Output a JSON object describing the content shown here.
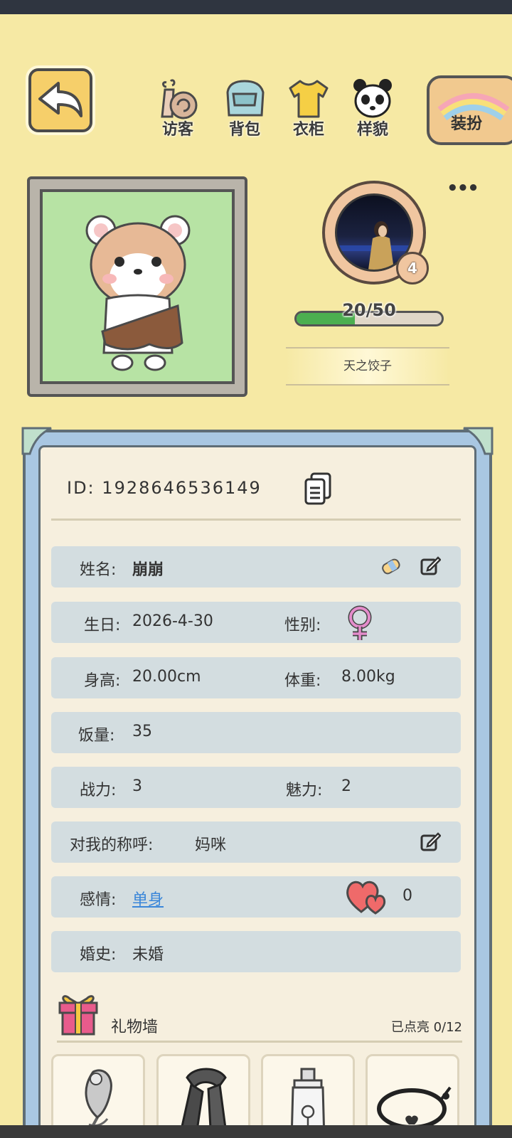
{
  "nav": {
    "visitors": "访客",
    "backpack": "背包",
    "wardrobe": "衣柜",
    "appearance": "样貌",
    "dress_up": "装扮"
  },
  "profile": {
    "level": "4",
    "exp_text": "20/50",
    "exp_progress": 0.4,
    "owner_name": "天之饺子"
  },
  "info": {
    "id_label": "ID:",
    "id_value": "1928646536149",
    "name_label": "姓名:",
    "name_value": "崩崩",
    "birthday_label": "生日:",
    "birthday_value": "2026-4-30",
    "gender_label": "性别:",
    "gender_icon": "female-symbol-icon",
    "height_label": "身高:",
    "height_value": "20.00cm",
    "weight_label": "体重:",
    "weight_value": "8.00kg",
    "appetite_label": "饭量:",
    "appetite_value": "35",
    "combat_label": "战力:",
    "combat_value": "3",
    "charm_label": "魅力:",
    "charm_value": "2",
    "address_label": "对我的称呼:",
    "address_value": "妈咪",
    "relationship_label": "感情:",
    "relationship_value": "单身",
    "hearts_count": "0",
    "marriage_label": "婚史:",
    "marriage_value": "未婚"
  },
  "gift_wall": {
    "title": "礼物墙",
    "lit_label": "已点亮",
    "lit_count": "0/12",
    "items": [
      "feather-brooch-icon",
      "scarf-icon",
      "perfume-bottle-icon",
      "bracelet-icon"
    ]
  },
  "colors": {
    "background": "#f6e9a4",
    "row_bg": "#d3dde0",
    "card_border": "#a9c7e2",
    "exp_fill": "#4caf50",
    "link": "#3a86d9",
    "gender": "#d86bb3"
  }
}
